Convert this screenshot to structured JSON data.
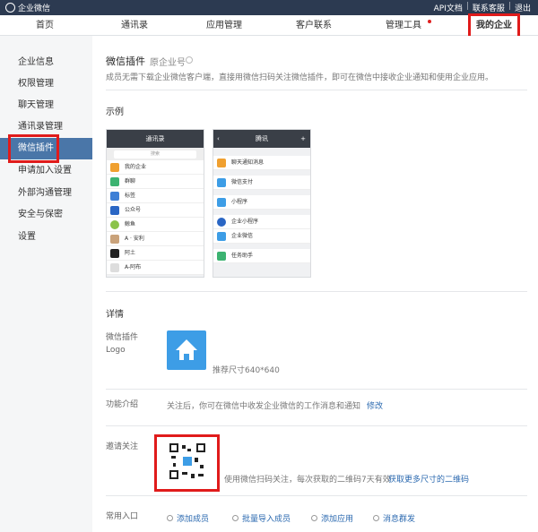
{
  "topbar": {
    "brand": "企业微信",
    "links": [
      "API文档",
      "联系客服",
      "退出"
    ]
  },
  "nav": {
    "items": [
      "首页",
      "通讯录",
      "应用管理",
      "客户联系",
      "管理工具",
      "我的企业"
    ]
  },
  "sidebar": {
    "items": [
      "企业信息",
      "权限管理",
      "聊天管理",
      "通讯录管理",
      "微信插件",
      "申请加入设置",
      "外部沟通管理",
      "安全与保密",
      "设置"
    ]
  },
  "main": {
    "title": "微信插件",
    "subtitle": "原企业号",
    "desc": "成员无需下载企业微信客户端，直接用微信扫码关注微信插件，即可在微信中接收企业通知和使用企业应用。",
    "example_label": "示例",
    "phone1": {
      "title": "通讯录",
      "search": "搜索",
      "rows": [
        "我的企业",
        "群聊",
        "标签",
        "公众号",
        "鲸鱼",
        "A · 安利",
        "阿土",
        "A-阿布"
      ]
    },
    "phone2": {
      "title": "腾讯",
      "rows": [
        "聊天通知消息",
        "微信支付",
        "小程序",
        "企业小程序",
        "企业微信",
        "任务助手"
      ]
    },
    "details_label": "详情",
    "logo_label": "微信插件\nLogo",
    "logo_hint": "推荐尺寸640*640",
    "intro_label": "功能介绍",
    "intro_text": "关注后，你可在微信中收发企业微信的工作消息和通知",
    "intro_edit": "修改",
    "invite_label": "邀请关注",
    "invite_text": "使用微信扫码关注，每次获取的二维码7天有效",
    "invite_link": "获取更多尺寸的二维码",
    "entry_label": "常用入口",
    "entries": [
      "添加成员",
      "批量导入成员",
      "添加应用",
      "消息群发"
    ]
  }
}
